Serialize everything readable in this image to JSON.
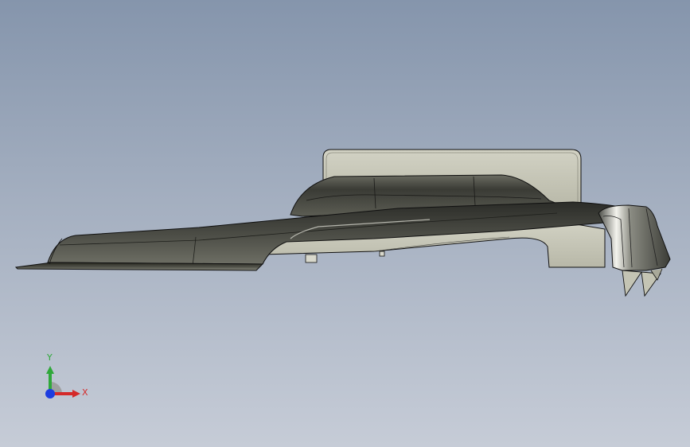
{
  "viewport": {
    "background_top": "#8595ac",
    "background_bottom": "#c6ccd7"
  },
  "model": {
    "icon": "cad-part-model",
    "dark_surface": "#3d3e38",
    "light_surface": "#c8c8ba",
    "edge_color": "#101010"
  },
  "triad": {
    "x_label": "X",
    "y_label": "Y",
    "x_color": "#d42a2a",
    "y_color": "#2fa83a",
    "z_color": "#1d3de0"
  }
}
